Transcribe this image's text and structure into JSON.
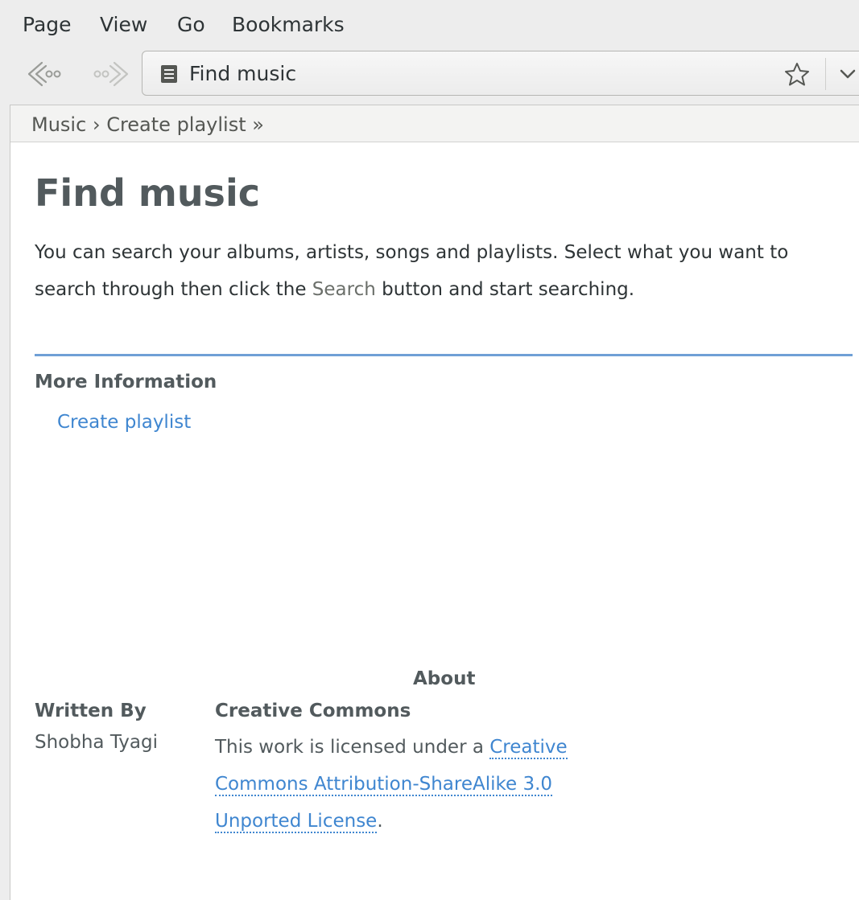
{
  "menubar": {
    "items": [
      "Page",
      "View",
      "Go",
      "Bookmarks"
    ]
  },
  "toolbar": {
    "back_icon": "back-arrow-icon",
    "forward_icon": "forward-arrow-icon",
    "url_text": "Find music",
    "bookmark_icon": "star-icon",
    "dropdown_icon": "chevron-down-icon"
  },
  "trail": {
    "crumb_1": "Music",
    "separator": "›",
    "crumb_2": "Create playlist",
    "trailing": "»"
  },
  "page": {
    "title": "Find music",
    "intro_before": "You can search your albums, artists, songs and playlists. Select what you want to search through then click the ",
    "intro_gui": "Search",
    "intro_after": " button and start searching."
  },
  "more_info": {
    "heading": "More Information",
    "links": [
      "Create playlist"
    ]
  },
  "about": {
    "heading": "About",
    "credits_heading": "Written By",
    "credits_name": "Shobha Tyagi",
    "license_heading": "Creative Commons",
    "license_before": "This work is licensed under a ",
    "license_link": "Creative Commons Attribution-ShareAlike 3.0 Unported License",
    "license_after": "."
  },
  "colors": {
    "link": "#3f86d0",
    "rule": "#6fa0d6",
    "heading": "#525a5d"
  }
}
